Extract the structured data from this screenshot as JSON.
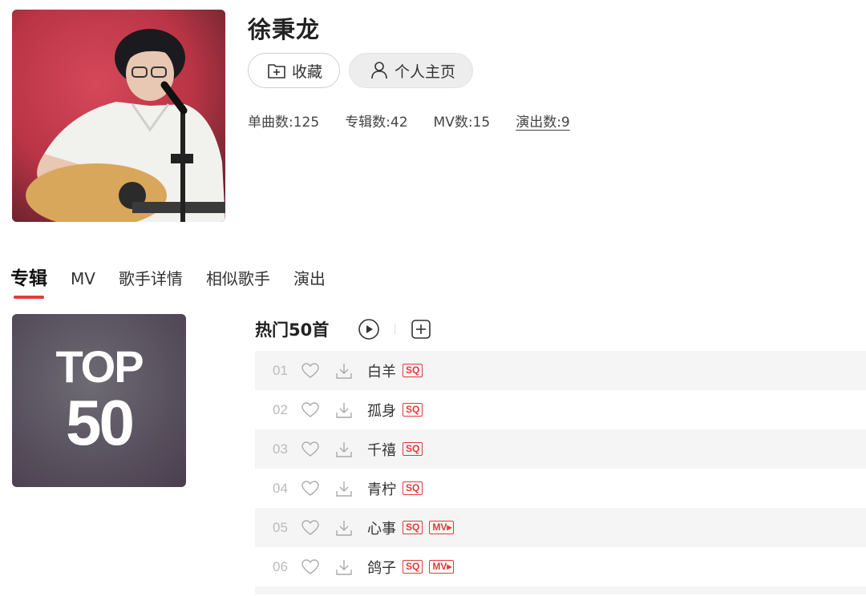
{
  "artist": {
    "name": "徐秉龙",
    "collect_label": "收藏",
    "homepage_label": "个人主页",
    "stats": {
      "songs": "单曲数:125",
      "albums": "专辑数:42",
      "mvs": "MV数:15",
      "performances": "演出数:9"
    }
  },
  "tabs": [
    {
      "label": "专辑",
      "active": true
    },
    {
      "label": "MV"
    },
    {
      "label": "歌手详情"
    },
    {
      "label": "相似歌手"
    },
    {
      "label": "演出"
    }
  ],
  "cover": {
    "line1": "TOP",
    "line2": "50"
  },
  "hot": {
    "title": "热门50首",
    "songs": [
      {
        "num": "01",
        "name": "白羊",
        "sq": "SQ"
      },
      {
        "num": "02",
        "name": "孤身",
        "sq": "SQ"
      },
      {
        "num": "03",
        "name": "千禧",
        "sq": "SQ"
      },
      {
        "num": "04",
        "name": "青柠",
        "sq": "SQ"
      },
      {
        "num": "05",
        "name": "心事",
        "sq": "SQ",
        "mv": "MV▸"
      },
      {
        "num": "06",
        "name": "鸽子",
        "sq": "SQ",
        "mv": "MV▸"
      }
    ]
  },
  "colors": {
    "accent": "#e33b3b",
    "badge": "#e03a3a",
    "stripe": "#f5f5f5"
  },
  "icons": [
    "plus-square-icon",
    "user-icon",
    "play-circle-icon",
    "heart-icon",
    "download-icon"
  ]
}
